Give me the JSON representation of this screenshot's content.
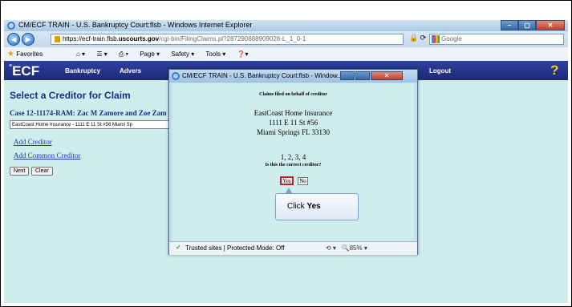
{
  "browser": {
    "title": "CM/ECF TRAIN - U.S. Bankruptcy Court:flsb - Windows Internet Explorer",
    "url_scheme": "https://",
    "url_host_a": "ecf-train.flsb.",
    "url_host_b": "uscourts.gov",
    "url_rest": "/cgi-bin/FilingClaims.pl?287290888909028-L_1_0-1",
    "search_engine": "Google",
    "favorites_label": "Favorites",
    "toolbar_items": [
      "Page ▾",
      "Safety ▾",
      "Tools ▾"
    ]
  },
  "ecf": {
    "logo": "ECF",
    "menu": [
      {
        "label": "Bankruptcy",
        "name": "menu-bankruptcy"
      },
      {
        "label": "Advers",
        "name": "menu-adversary"
      },
      {
        "label": "Logout",
        "name": "menu-logout"
      }
    ],
    "help_glyph": "?"
  },
  "main": {
    "title": "Select a Creditor for Claim",
    "case_line": "Case 12-11174-RAM: Zac M Zamore and Zoe Zam",
    "creditor_selection": "EastCoast Home Insurance - 1111 E 11 St #56 Miami Sp",
    "add_creditor": "Add Creditor",
    "add_common_creditor": "Add Common Creditor",
    "next_label": "Next",
    "clear_label": "Clear"
  },
  "popup": {
    "title": "CM/ECF TRAIN - U.S. Bankruptcy Court:flsb - Window...",
    "header": "Claims filed on behalf of creditor",
    "creditor_name": "EastCoast Home Insurance",
    "address1": "1111 E 11 St #56",
    "address2": "Miami Springs FL 33130",
    "claim_numbers": "1, 2, 3, 4",
    "question": "Is this the correct creditor?",
    "yes_label": "Yes",
    "no_label": "No",
    "callout_prefix": "Click ",
    "callout_bold": "Yes",
    "status_text": "Trusted sites | Protected Mode: Off",
    "zoom": "85%"
  },
  "colors": {
    "page_bg": "#d0eded",
    "ecf_bar": "#1d2a78",
    "title_text": "#1d2a8a",
    "highlight": "#c0202a"
  }
}
